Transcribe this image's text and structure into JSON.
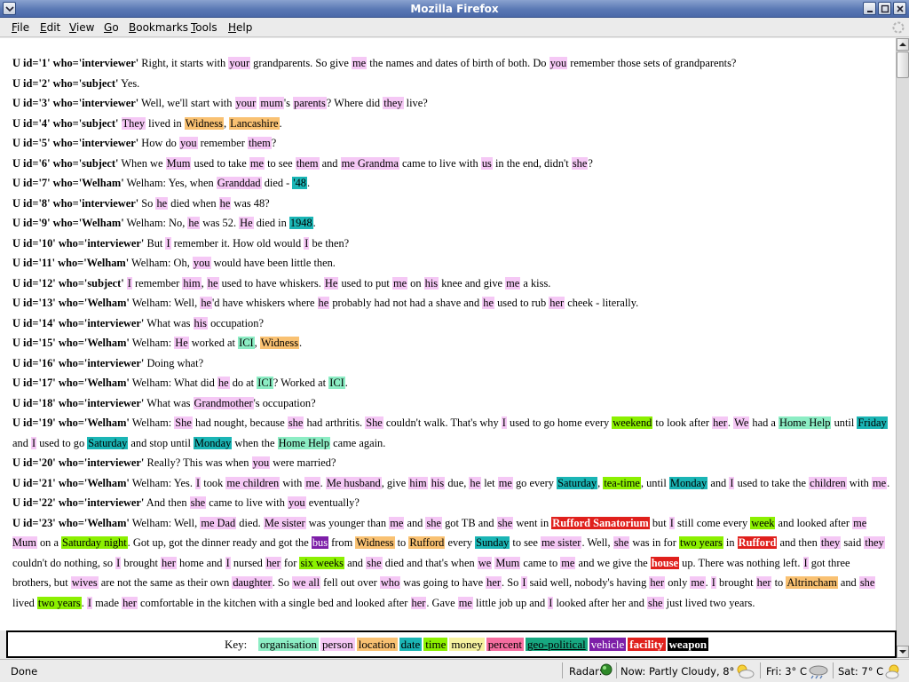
{
  "window": {
    "title": "Mozilla Firefox"
  },
  "menu": [
    "File",
    "Edit",
    "View",
    "Go",
    "Bookmarks",
    "Tools",
    "Help"
  ],
  "utterances": [
    [
      {
        "s": "U id='1' who='interviewer'"
      },
      {
        "t": " Right, it starts with "
      },
      {
        "e": "your",
        "c": "person"
      },
      {
        "t": " grandparents. So give "
      },
      {
        "e": "me",
        "c": "person"
      },
      {
        "t": " the names and dates of birth of both. Do "
      },
      {
        "e": "you",
        "c": "person"
      },
      {
        "t": " remember those sets of grandparents?"
      }
    ],
    [
      {
        "s": "U id='2' who='subject'"
      },
      {
        "t": " Yes."
      }
    ],
    [
      {
        "s": "U id='3' who='interviewer'"
      },
      {
        "t": " Well, we'll start with "
      },
      {
        "e": "your",
        "c": "person"
      },
      {
        "t": " "
      },
      {
        "e": "mum",
        "c": "person"
      },
      {
        "t": "'s "
      },
      {
        "e": "parents",
        "c": "person"
      },
      {
        "t": "? Where did "
      },
      {
        "e": "they",
        "c": "person"
      },
      {
        "t": " live?"
      }
    ],
    [
      {
        "s": "U id='4' who='subject'"
      },
      {
        "t": " "
      },
      {
        "e": "They",
        "c": "person"
      },
      {
        "t": " lived in "
      },
      {
        "e": "Widness",
        "c": "location"
      },
      {
        "t": ", "
      },
      {
        "e": "Lancashire",
        "c": "location"
      },
      {
        "t": "."
      }
    ],
    [
      {
        "s": "U id='5' who='interviewer'"
      },
      {
        "t": " How do "
      },
      {
        "e": "you",
        "c": "person"
      },
      {
        "t": " remember "
      },
      {
        "e": "them",
        "c": "person"
      },
      {
        "t": "?"
      }
    ],
    [
      {
        "s": "U id='6' who='subject'"
      },
      {
        "t": " When we "
      },
      {
        "e": "Mum",
        "c": "person"
      },
      {
        "t": " used to take "
      },
      {
        "e": "me",
        "c": "person"
      },
      {
        "t": " to see "
      },
      {
        "e": "them",
        "c": "person"
      },
      {
        "t": " and "
      },
      {
        "e": "me Grandma",
        "c": "person"
      },
      {
        "t": " came to live with "
      },
      {
        "e": "us",
        "c": "person"
      },
      {
        "t": " in the end, didn't "
      },
      {
        "e": "she",
        "c": "person"
      },
      {
        "t": "?"
      }
    ],
    [
      {
        "s": "U id='7' who='Welham'"
      },
      {
        "t": " Welham: Yes, when "
      },
      {
        "e": "Granddad",
        "c": "person"
      },
      {
        "t": " died - "
      },
      {
        "e": "'48",
        "c": "date"
      },
      {
        "t": "."
      }
    ],
    [
      {
        "s": "U id='8' who='interviewer'"
      },
      {
        "t": " So "
      },
      {
        "e": "he",
        "c": "person"
      },
      {
        "t": " died when "
      },
      {
        "e": "he",
        "c": "person"
      },
      {
        "t": " was 48?"
      }
    ],
    [
      {
        "s": "U id='9' who='Welham'"
      },
      {
        "t": " Welham: No, "
      },
      {
        "e": "he",
        "c": "person"
      },
      {
        "t": " was 52. "
      },
      {
        "e": "He",
        "c": "person"
      },
      {
        "t": " died in "
      },
      {
        "e": "1948",
        "c": "date"
      },
      {
        "t": "."
      }
    ],
    [
      {
        "s": "U id='10' who='interviewer'"
      },
      {
        "t": " But "
      },
      {
        "e": "I",
        "c": "person"
      },
      {
        "t": " remember it. How old would "
      },
      {
        "e": "I",
        "c": "person"
      },
      {
        "t": " be then?"
      }
    ],
    [
      {
        "s": "U id='11' who='Welham'"
      },
      {
        "t": " Welham: Oh, "
      },
      {
        "e": "you",
        "c": "person"
      },
      {
        "t": " would have been little then."
      }
    ],
    [
      {
        "s": "U id='12' who='subject'"
      },
      {
        "t": " "
      },
      {
        "e": "I",
        "c": "person"
      },
      {
        "t": " remember "
      },
      {
        "e": "him",
        "c": "person"
      },
      {
        "t": ", "
      },
      {
        "e": "he",
        "c": "person"
      },
      {
        "t": " used to have whiskers. "
      },
      {
        "e": "He",
        "c": "person"
      },
      {
        "t": " used to put "
      },
      {
        "e": "me",
        "c": "person"
      },
      {
        "t": " on "
      },
      {
        "e": "his",
        "c": "person"
      },
      {
        "t": " knee and give "
      },
      {
        "e": "me",
        "c": "person"
      },
      {
        "t": " a kiss."
      }
    ],
    [
      {
        "s": "U id='13' who='Welham'"
      },
      {
        "t": " Welham: Well, "
      },
      {
        "e": "he",
        "c": "person"
      },
      {
        "t": "'d have whiskers where "
      },
      {
        "e": "he",
        "c": "person"
      },
      {
        "t": " probably had not had a shave and "
      },
      {
        "e": "he",
        "c": "person"
      },
      {
        "t": " used to rub "
      },
      {
        "e": "her",
        "c": "person"
      },
      {
        "t": " cheek - literally."
      }
    ],
    [
      {
        "s": "U id='14' who='interviewer'"
      },
      {
        "t": " What was "
      },
      {
        "e": "his",
        "c": "person"
      },
      {
        "t": " occupation?"
      }
    ],
    [
      {
        "s": "U id='15' who='Welham'"
      },
      {
        "t": " Welham: "
      },
      {
        "e": "He",
        "c": "person"
      },
      {
        "t": " worked at "
      },
      {
        "e": "ICI",
        "c": "organisation"
      },
      {
        "t": ", "
      },
      {
        "e": "Widness",
        "c": "location"
      },
      {
        "t": "."
      }
    ],
    [
      {
        "s": "U id='16' who='interviewer'"
      },
      {
        "t": " Doing what?"
      }
    ],
    [
      {
        "s": "U id='17' who='Welham'"
      },
      {
        "t": " Welham: What did "
      },
      {
        "e": "he",
        "c": "person"
      },
      {
        "t": " do at "
      },
      {
        "e": "ICI",
        "c": "organisation"
      },
      {
        "t": "? Worked at "
      },
      {
        "e": "ICI",
        "c": "organisation"
      },
      {
        "t": "."
      }
    ],
    [
      {
        "s": "U id='18' who='interviewer'"
      },
      {
        "t": " What was "
      },
      {
        "e": "Grandmother",
        "c": "person"
      },
      {
        "t": "'s occupation?"
      }
    ],
    [
      {
        "s": "U id='19' who='Welham'"
      },
      {
        "t": " Welham: "
      },
      {
        "e": "She",
        "c": "person"
      },
      {
        "t": " had nought, because "
      },
      {
        "e": "she",
        "c": "person"
      },
      {
        "t": " had arthritis. "
      },
      {
        "e": "She",
        "c": "person"
      },
      {
        "t": " couldn't walk. That's why "
      },
      {
        "e": "I",
        "c": "person"
      },
      {
        "t": " used to go home every "
      },
      {
        "e": "weekend",
        "c": "time"
      },
      {
        "t": " to look after "
      },
      {
        "e": "her",
        "c": "person"
      },
      {
        "t": ". "
      },
      {
        "e": "We",
        "c": "person"
      },
      {
        "t": " had a "
      },
      {
        "e": "Home Help",
        "c": "organisation"
      },
      {
        "t": " until "
      },
      {
        "e": "Friday",
        "c": "date"
      },
      {
        "t": " and "
      },
      {
        "e": "I",
        "c": "person"
      },
      {
        "t": " used to go "
      },
      {
        "e": "Saturday",
        "c": "date"
      },
      {
        "t": " and stop until "
      },
      {
        "e": "Monday",
        "c": "date"
      },
      {
        "t": " when the "
      },
      {
        "e": "Home Help",
        "c": "organisation"
      },
      {
        "t": " came again."
      }
    ],
    [
      {
        "s": "U id='20' who='interviewer'"
      },
      {
        "t": " Really? This was when "
      },
      {
        "e": "you",
        "c": "person"
      },
      {
        "t": " were married?"
      }
    ],
    [
      {
        "s": "U id='21' who='Welham'"
      },
      {
        "t": " Welham: Yes. "
      },
      {
        "e": "I",
        "c": "person"
      },
      {
        "t": " took "
      },
      {
        "e": "me children",
        "c": "person"
      },
      {
        "t": " with "
      },
      {
        "e": "me",
        "c": "person"
      },
      {
        "t": ". "
      },
      {
        "e": "Me husband",
        "c": "person"
      },
      {
        "t": ", give "
      },
      {
        "e": "him",
        "c": "person"
      },
      {
        "t": " "
      },
      {
        "e": "his",
        "c": "person"
      },
      {
        "t": " due, "
      },
      {
        "e": "he",
        "c": "person"
      },
      {
        "t": " let "
      },
      {
        "e": "me",
        "c": "person"
      },
      {
        "t": " go every "
      },
      {
        "e": "Saturday",
        "c": "date"
      },
      {
        "t": ", "
      },
      {
        "e": "tea-time",
        "c": "time"
      },
      {
        "t": ", until "
      },
      {
        "e": "Monday",
        "c": "date"
      },
      {
        "t": " and "
      },
      {
        "e": "I",
        "c": "person"
      },
      {
        "t": " used to take the "
      },
      {
        "e": "children",
        "c": "person"
      },
      {
        "t": " with "
      },
      {
        "e": "me",
        "c": "person"
      },
      {
        "t": "."
      }
    ],
    [
      {
        "s": "U id='22' who='interviewer'"
      },
      {
        "t": " And then "
      },
      {
        "e": "she",
        "c": "person"
      },
      {
        "t": " came to live with "
      },
      {
        "e": "you",
        "c": "person"
      },
      {
        "t": " eventually?"
      }
    ],
    [
      {
        "s": "U id='23' who='Welham'"
      },
      {
        "t": " Welham: Well, "
      },
      {
        "e": "me Dad",
        "c": "person"
      },
      {
        "t": " died. "
      },
      {
        "e": "Me sister",
        "c": "person"
      },
      {
        "t": " was younger than "
      },
      {
        "e": "me",
        "c": "person"
      },
      {
        "t": " and "
      },
      {
        "e": "she",
        "c": "person"
      },
      {
        "t": " got TB and "
      },
      {
        "e": "she",
        "c": "person"
      },
      {
        "t": " went in "
      },
      {
        "e": "Rufford Sanatorium",
        "c": "facility"
      },
      {
        "t": " but "
      },
      {
        "e": "I",
        "c": "person"
      },
      {
        "t": " still come every "
      },
      {
        "e": "week",
        "c": "time"
      },
      {
        "t": " and looked after "
      },
      {
        "e": "me Mum",
        "c": "person"
      },
      {
        "t": " on a "
      },
      {
        "e": "Saturday night",
        "c": "time"
      },
      {
        "t": ". Got up, got the dinner ready and got the "
      },
      {
        "e": "bus",
        "c": "vehicle"
      },
      {
        "t": " from "
      },
      {
        "e": "Widness",
        "c": "location"
      },
      {
        "t": " to "
      },
      {
        "e": "Rufford",
        "c": "location"
      },
      {
        "t": " every "
      },
      {
        "e": "Sunday",
        "c": "date"
      },
      {
        "t": " to see "
      },
      {
        "e": "me sister",
        "c": "person"
      },
      {
        "t": ". Well, "
      },
      {
        "e": "she",
        "c": "person"
      },
      {
        "t": " was in for "
      },
      {
        "e": "two years",
        "c": "time"
      },
      {
        "t": " in "
      },
      {
        "e": "Rufford",
        "c": "facility"
      },
      {
        "t": " and then "
      },
      {
        "e": "they",
        "c": "person"
      },
      {
        "t": " said "
      },
      {
        "e": "they",
        "c": "person"
      },
      {
        "t": " couldn't do nothing, so "
      },
      {
        "e": "I",
        "c": "person"
      },
      {
        "t": " brought "
      },
      {
        "e": "her",
        "c": "person"
      },
      {
        "t": " home and "
      },
      {
        "e": "I",
        "c": "person"
      },
      {
        "t": " nursed "
      },
      {
        "e": "her",
        "c": "person"
      },
      {
        "t": " for "
      },
      {
        "e": "six weeks",
        "c": "time"
      },
      {
        "t": " and "
      },
      {
        "e": "she",
        "c": "person"
      },
      {
        "t": " died and that's when "
      },
      {
        "e": "we",
        "c": "person"
      },
      {
        "t": " "
      },
      {
        "e": "Mum",
        "c": "person"
      },
      {
        "t": " came to "
      },
      {
        "e": "me",
        "c": "person"
      },
      {
        "t": " and we give the "
      },
      {
        "e": "house",
        "c": "facility"
      },
      {
        "t": " up. There was nothing left. "
      },
      {
        "e": "I",
        "c": "person"
      },
      {
        "t": " got three brothers, but "
      },
      {
        "e": "wives",
        "c": "person"
      },
      {
        "t": " are not the same as their own "
      },
      {
        "e": "daughter",
        "c": "person"
      },
      {
        "t": ". So "
      },
      {
        "e": "we all",
        "c": "person"
      },
      {
        "t": " fell out over "
      },
      {
        "e": "who",
        "c": "person"
      },
      {
        "t": " was going to have "
      },
      {
        "e": "her",
        "c": "person"
      },
      {
        "t": ". So "
      },
      {
        "e": "I",
        "c": "person"
      },
      {
        "t": " said well, nobody's having "
      },
      {
        "e": "her",
        "c": "person"
      },
      {
        "t": " only "
      },
      {
        "e": "me",
        "c": "person"
      },
      {
        "t": ". "
      },
      {
        "e": "I",
        "c": "person"
      },
      {
        "t": " brought "
      },
      {
        "e": "her",
        "c": "person"
      },
      {
        "t": " to "
      },
      {
        "e": "Altrincham",
        "c": "location"
      },
      {
        "t": " and "
      },
      {
        "e": "she",
        "c": "person"
      },
      {
        "t": " lived "
      },
      {
        "e": "two years",
        "c": "time"
      },
      {
        "t": ". "
      },
      {
        "e": "I",
        "c": "person"
      },
      {
        "t": " made "
      },
      {
        "e": "her",
        "c": "person"
      },
      {
        "t": " comfortable in the kitchen with a single bed and looked after "
      },
      {
        "e": "her",
        "c": "person"
      },
      {
        "t": ". Gave "
      },
      {
        "e": "me",
        "c": "person"
      },
      {
        "t": " little job up and "
      },
      {
        "e": "I",
        "c": "person"
      },
      {
        "t": " looked after her and "
      },
      {
        "e": "she",
        "c": "person"
      },
      {
        "t": " just lived two years."
      }
    ]
  ],
  "key": {
    "label": "Key:",
    "items": [
      {
        "label": "organisation",
        "c": "organisation"
      },
      {
        "label": "person",
        "c": "person"
      },
      {
        "label": "location",
        "c": "location"
      },
      {
        "label": "date",
        "c": "date"
      },
      {
        "label": "time",
        "c": "time"
      },
      {
        "label": "money",
        "c": "money"
      },
      {
        "label": "percent",
        "c": "percent"
      },
      {
        "label": "geo-political",
        "c": "geo"
      },
      {
        "label": "vehicle",
        "c": "vehicle"
      },
      {
        "label": "facility",
        "c": "facility"
      },
      {
        "label": "weapon",
        "c": "weapon"
      }
    ]
  },
  "entity_colors": {
    "organisation": "#8cedc4",
    "person": "#f5c8f5",
    "location": "#f9c172",
    "date": "#1ab5b5",
    "time": "#8bf000",
    "money": "#f6f2a0",
    "percent": "#f56ea0",
    "geo": "#17a780",
    "vehicle": "#7d1ea8",
    "facility": "#e0201c",
    "weapon": "#000000"
  },
  "status": {
    "text": "Done",
    "radar_label": "Radar:",
    "weather_now": "Now: Partly Cloudy, 8° C",
    "weather_fri": "Fri: 3° C",
    "weather_sat": "Sat: 7° C",
    "icons": [
      "radar-icon",
      "partly-cloudy-icon",
      "rain-cloud-icon",
      "sun-cloud-icon"
    ]
  }
}
